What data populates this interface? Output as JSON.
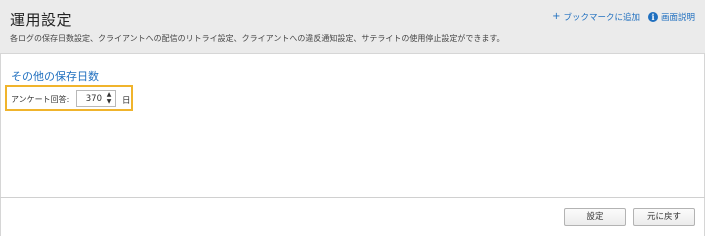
{
  "header": {
    "title": "運用設定",
    "description": "各ログの保存日数設定、クライアントへの配信のリトライ設定、クライアントへの違反通知設定、サテライトの使用停止設定ができます。",
    "bookmark_label": "ブックマークに追加",
    "bookmark_icon": "plus-icon",
    "help_label": "画面説明",
    "help_icon": "info-icon"
  },
  "section": {
    "title": "その他の保存日数",
    "field_label": "アンケート回答:",
    "field_value": "370",
    "unit": "日"
  },
  "footer": {
    "save_label": "設定",
    "reset_label": "元に戻す"
  },
  "colors": {
    "accent": "#1f6fbf",
    "highlight": "#f0b42c",
    "header_bg": "#ebebeb"
  }
}
